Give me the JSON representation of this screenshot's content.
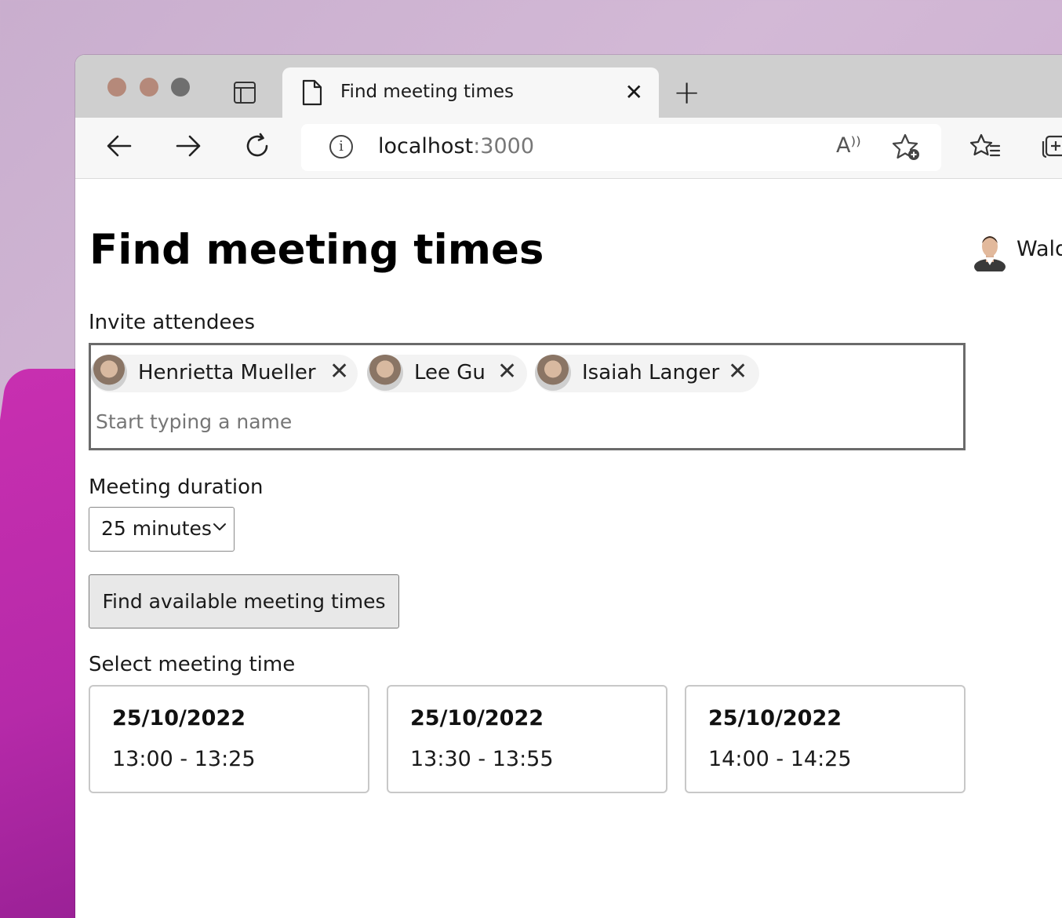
{
  "browser": {
    "tab_title": "Find meeting times",
    "tab_close": "✕",
    "new_tab": "+",
    "url_host": "localhost",
    "url_port": ":3000",
    "read_aloud": "A⁾⁾"
  },
  "page": {
    "title": "Find meeting times",
    "user_name": "Waldo"
  },
  "attendees": {
    "label": "Invite attendees",
    "placeholder": "Start typing a name",
    "people": [
      {
        "name": "Henrietta Mueller"
      },
      {
        "name": "Lee Gu"
      },
      {
        "name": "Isaiah Langer"
      }
    ]
  },
  "duration": {
    "label": "Meeting duration",
    "selected": "25 minutes"
  },
  "find_button": {
    "label": "Find available meeting times"
  },
  "slots": {
    "label": "Select meeting time",
    "items": [
      {
        "date": "25/10/2022",
        "time": "13:00 - 13:25"
      },
      {
        "date": "25/10/2022",
        "time": "13:30 - 13:55"
      },
      {
        "date": "25/10/2022",
        "time": "14:00 - 14:25"
      }
    ]
  },
  "icons": {
    "back": "arrow-left-icon",
    "forward": "arrow-right-icon",
    "refresh": "refresh-icon",
    "info": "info-icon",
    "favorites_add": "star-add-icon",
    "favorites": "favorites-icon",
    "collections": "collections-icon"
  }
}
